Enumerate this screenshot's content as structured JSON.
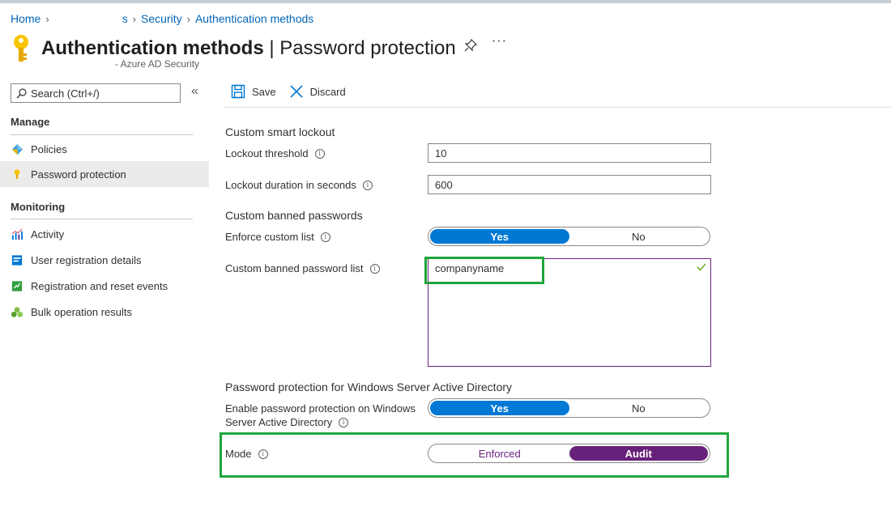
{
  "breadcrumb": {
    "home": "Home",
    "truncated": "s",
    "security": "Security",
    "auth_methods": "Authentication methods"
  },
  "header": {
    "title_strong": "Authentication methods",
    "title_sep": " | ",
    "title_light": "Password protection",
    "subtitle": "- Azure AD Security",
    "more": "···"
  },
  "sidebar": {
    "search_placeholder": "Search (Ctrl+/)",
    "collapse": "«",
    "manage_header": "Manage",
    "manage_items": [
      {
        "label": "Policies",
        "icon": "policies-icon"
      },
      {
        "label": "Password protection",
        "icon": "key-icon",
        "selected": true
      }
    ],
    "monitoring_header": "Monitoring",
    "monitoring_items": [
      {
        "label": "Activity",
        "icon": "activity-chart-icon"
      },
      {
        "label": "User registration details",
        "icon": "user-registration-icon"
      },
      {
        "label": "Registration and reset events",
        "icon": "registration-events-icon"
      },
      {
        "label": "Bulk operation results",
        "icon": "bulk-operations-icon"
      }
    ]
  },
  "toolbar": {
    "save_label": "Save",
    "discard_label": "Discard"
  },
  "form": {
    "smart_lockout_header": "Custom smart lockout",
    "lockout_threshold_label": "Lockout threshold",
    "lockout_threshold_value": "10",
    "lockout_duration_label": "Lockout duration in seconds",
    "lockout_duration_value": "600",
    "banned_header": "Custom banned passwords",
    "enforce_custom_label": "Enforce custom list",
    "enforce_yes": "Yes",
    "enforce_no": "No",
    "banned_list_label": "Custom banned password list",
    "banned_list_value": "companyname",
    "windows_header": "Password protection for Windows Server Active Directory",
    "enable_label_line1": "Enable password protection on Windows",
    "enable_label_line2": "Server Active Directory",
    "enable_yes": "Yes",
    "enable_no": "No",
    "mode_label": "Mode",
    "mode_enforced": "Enforced",
    "mode_audit": "Audit",
    "info_glyph": "i"
  },
  "colors": {
    "link_blue": "#0066b8",
    "toggle_blue": "#0078d4",
    "toggle_purple": "#68217a",
    "highlight_green": "#1fa63c"
  }
}
